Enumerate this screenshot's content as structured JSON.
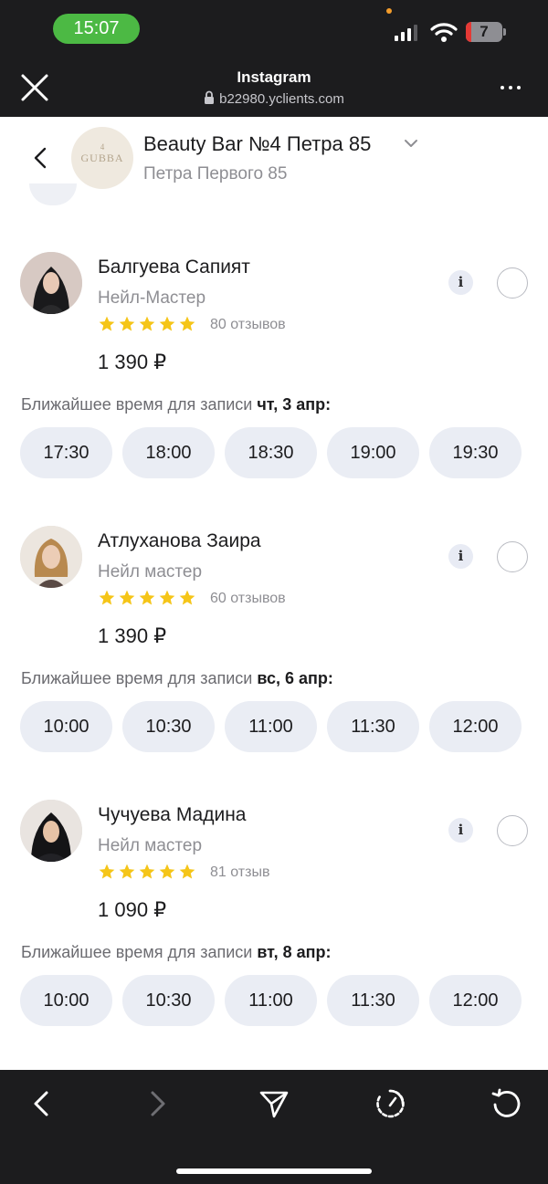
{
  "status_bar": {
    "time": "15:07",
    "battery": "7"
  },
  "browser": {
    "title": "Instagram",
    "url": "b22980.yclients.com"
  },
  "header": {
    "salon_name": "Beauty Bar №4 Петра 85",
    "salon_address": "Петра Первого 85",
    "logo_number": "4",
    "logo_text": "GUBBA"
  },
  "masters": [
    {
      "name": "Балгуева Сапият",
      "role": "Нейл-Мастер",
      "rating": 5,
      "reviews": "80 отзывов",
      "price": "1 390 ₽",
      "nearest_label": "Ближайшее время для записи",
      "nearest_date": "чт, 3 апр:",
      "slots": [
        "17:30",
        "18:00",
        "18:30",
        "19:00",
        "19:30"
      ]
    },
    {
      "name": "Атлуханова Заира",
      "role": "Нейл мастер",
      "rating": 5,
      "reviews": "60 отзывов",
      "price": "1 390 ₽",
      "nearest_label": "Ближайшее время для записи",
      "nearest_date": "вс, 6 апр:",
      "slots": [
        "10:00",
        "10:30",
        "11:00",
        "11:30",
        "12:00"
      ]
    },
    {
      "name": "Чучуева Мадина",
      "role": "Нейл мастер",
      "rating": 5,
      "reviews": "81 отзыв",
      "price": "1 090 ₽",
      "nearest_label": "Ближайшее время для записи",
      "nearest_date": "вт, 8 апр:",
      "slots": [
        "10:00",
        "10:30",
        "11:00",
        "11:30",
        "12:00"
      ]
    }
  ],
  "colors": {
    "star": "#f5c518",
    "slot_bg": "#eaedf4",
    "status_green": "#4cb944"
  },
  "icons": {
    "browser": [
      "close-icon",
      "lock-icon",
      "more-icon"
    ],
    "bottom_bar": [
      "back-icon",
      "forward-icon",
      "share-icon",
      "speed-icon",
      "reload-icon"
    ]
  }
}
